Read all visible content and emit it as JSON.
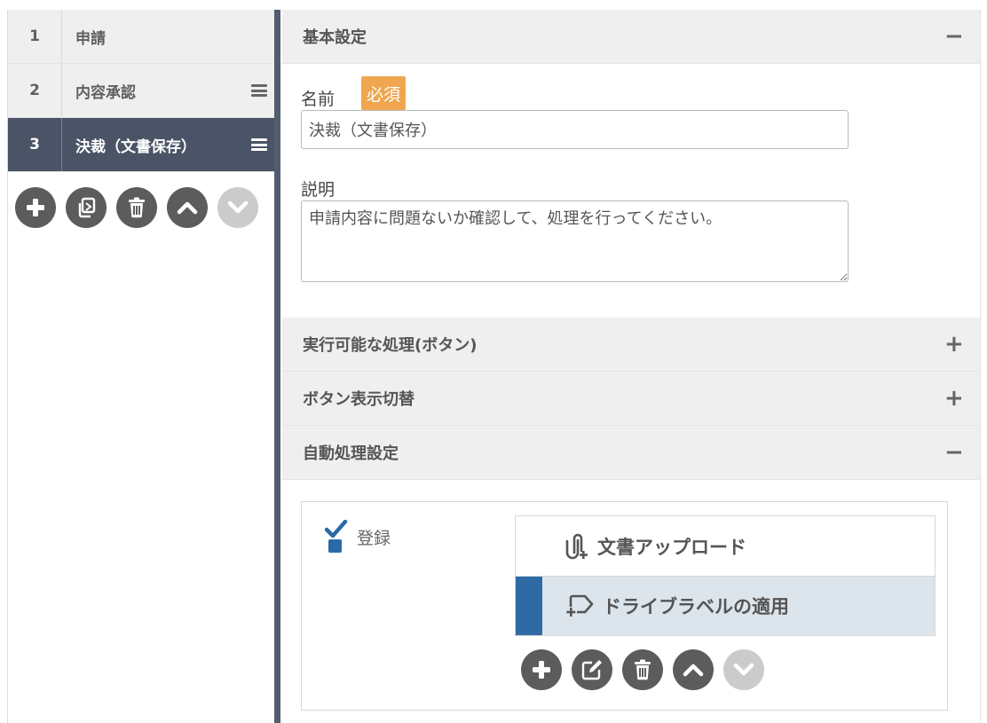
{
  "steps": [
    {
      "num": "1",
      "label": "申請",
      "active": false
    },
    {
      "num": "2",
      "label": "内容承認",
      "active": false
    },
    {
      "num": "3",
      "label": "決裁（文書保存）",
      "active": true
    }
  ],
  "step_tools": [
    "plus-icon",
    "copy-icon",
    "trash-icon",
    "chevron-up-icon",
    "chevron-down-icon"
  ],
  "basic": {
    "title": "基本設定",
    "toggle": "−",
    "name_label": "名前",
    "required_badge": "必須",
    "name_value": "決裁（文書保存）",
    "desc_label": "説明",
    "desc_value": "申請内容に問題ないか確認して、処理を行ってください。"
  },
  "sections": {
    "buttons_title": "実行可能な処理(ボタン)",
    "buttons_toggle": "+",
    "switch_title": "ボタン表示切替",
    "switch_toggle": "+",
    "auto_title": "自動処理設定",
    "auto_toggle": "−"
  },
  "auto": {
    "trigger_label": "登録",
    "actions": [
      {
        "label": "文書アップロード",
        "icon": "clip-plus-icon",
        "selected": false
      },
      {
        "label": "ドライブラベルの適用",
        "icon": "label-plus-icon",
        "selected": true
      }
    ],
    "tools": [
      "plus-icon",
      "edit-icon",
      "trash-icon",
      "chevron-up-icon",
      "chevron-down-icon"
    ]
  },
  "colors": {
    "active_step": "#4a5466",
    "required": "#f0a64f",
    "selected_action": "#2f6aa5",
    "trigger_icon": "#2a6aa8"
  }
}
